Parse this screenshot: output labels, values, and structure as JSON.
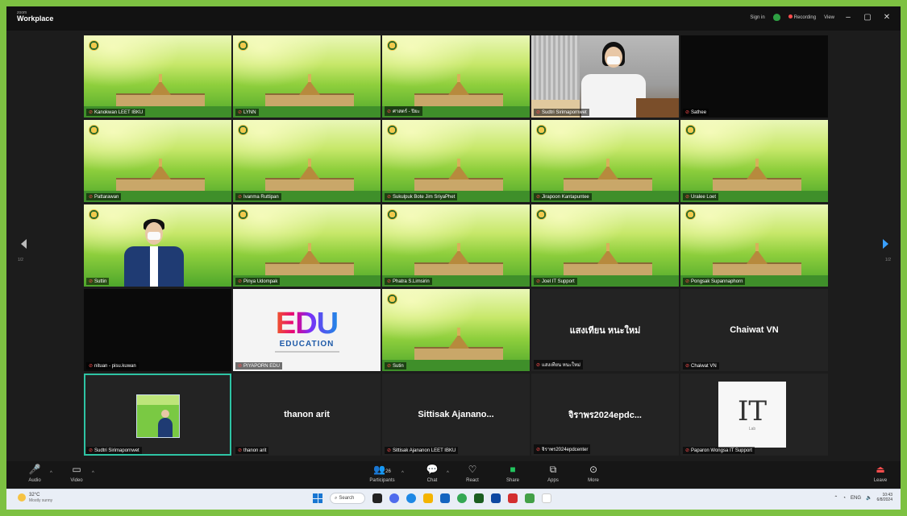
{
  "window": {
    "brand_top": "zoom",
    "brand_name": "Workplace",
    "view_label": "Sign in",
    "recording_label": "Recording",
    "view_menu": "View"
  },
  "tiles": [
    {
      "name": "Kanokwan LEET IBKU",
      "kind": "campus"
    },
    {
      "name": "LYNN",
      "kind": "campus"
    },
    {
      "name": "ศาสตร์ - ปิยะ",
      "kind": "campus"
    },
    {
      "name": "Sudtri Sirimapornwet",
      "kind": "person-woman"
    },
    {
      "name": "Sathee",
      "kind": "black"
    },
    {
      "name": "Pattarawan",
      "kind": "campus"
    },
    {
      "name": "Ivanma Ruttipan",
      "kind": "campus"
    },
    {
      "name": "Sukulpuk Bote Jim SriyaPhet",
      "kind": "campus"
    },
    {
      "name": "Jirapoon Kantapuntee",
      "kind": "campus"
    },
    {
      "name": "Uralee Loet",
      "kind": "campus"
    },
    {
      "name": "Suttin",
      "kind": "person-man"
    },
    {
      "name": "Pinya Udompak",
      "kind": "campus"
    },
    {
      "name": "Phatra S.Limsirin",
      "kind": "campus"
    },
    {
      "name": "Joel IT Support",
      "kind": "campus"
    },
    {
      "name": "Pongsak Supannaphorn",
      "kind": "campus"
    },
    {
      "name": "nituan - pisu.kuwan",
      "kind": "black"
    },
    {
      "name": "PIYAPORN EDU",
      "kind": "edu"
    },
    {
      "name": "Sutin",
      "kind": "campus"
    },
    {
      "name": "แสงเทียน หนะใหม่",
      "kind": "dark",
      "display": "แสงเทียน หนะใหม่"
    },
    {
      "name": "Chaiwat VN",
      "kind": "dark",
      "display": "Chaiwat VN"
    },
    {
      "name": "Sudtri Sirimapornwet",
      "kind": "thumb"
    },
    {
      "name": "thanon arit",
      "kind": "dark",
      "display": "thanon arit"
    },
    {
      "name": "Sittisak Ajananon LEET IBKU",
      "kind": "dark",
      "display": "Sittisak  Ajanano..."
    },
    {
      "name": "จิราพร2024epdcenter",
      "kind": "dark",
      "display": "จิราพร2024epdc..."
    },
    {
      "name": "Paparon Wongsa IT Support",
      "kind": "itcard"
    }
  ],
  "edu": {
    "logo": "EDU",
    "sub": "EDUCATION"
  },
  "itcard": {
    "logo": "IT",
    "sub": "Lab"
  },
  "nav": {
    "left_page": "1/2",
    "right_page": "1/2"
  },
  "toolbar": {
    "audio": "Audio",
    "video": "Video",
    "participants": "Participants",
    "participants_count": "26",
    "chat": "Chat",
    "react": "React",
    "share": "Share",
    "apps": "Apps",
    "more": "More",
    "leave": "Leave"
  },
  "taskbar": {
    "weather_temp": "32°C",
    "weather_desc": "Mostly sunny",
    "search": "Search",
    "time": "10:43",
    "date": "6/8/2024",
    "lang": "ENG"
  },
  "colors": {
    "accent": "#2ec4a4",
    "frame": "#7dc142",
    "danger": "#ff4d4d",
    "share": "#22c55e"
  }
}
